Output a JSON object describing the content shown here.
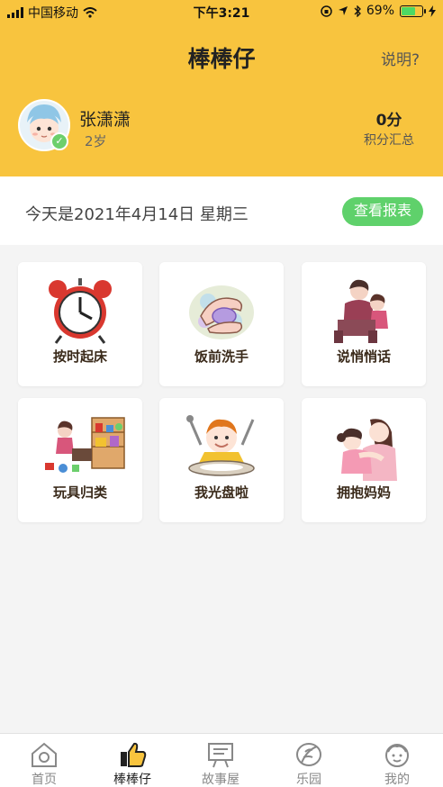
{
  "status_bar": {
    "carrier": "中国移动",
    "time": "下午3:21",
    "battery": "69%",
    "battery_level": 0.69
  },
  "header": {
    "title": "棒棒仔",
    "help": "说明?"
  },
  "profile": {
    "name": "张潇潇",
    "age": "2岁",
    "score": "0分",
    "score_label": "积分汇总"
  },
  "date_bar": {
    "date_text": "今天是2021年4月14日  星期三",
    "report_button": "查看报表"
  },
  "tasks": [
    {
      "label": "按时起床",
      "icon": "alarm-clock-icon"
    },
    {
      "label": "饭前洗手",
      "icon": "hand-washing-icon"
    },
    {
      "label": "说悄悄话",
      "icon": "whisper-icon"
    },
    {
      "label": "玩具归类",
      "icon": "toy-shelf-icon"
    },
    {
      "label": "我光盘啦",
      "icon": "clean-plate-icon"
    },
    {
      "label": "拥抱妈妈",
      "icon": "hug-mom-icon"
    }
  ],
  "tabbar": [
    {
      "label": "首页",
      "icon": "home-icon",
      "active": false
    },
    {
      "label": "棒棒仔",
      "icon": "thumbs-up-icon",
      "active": true
    },
    {
      "label": "故事屋",
      "icon": "story-board-icon",
      "active": false
    },
    {
      "label": "乐园",
      "icon": "leaf-icon",
      "active": false
    },
    {
      "label": "我的",
      "icon": "child-face-icon",
      "active": false
    }
  ],
  "colors": {
    "accent": "#f8c43e",
    "button_green": "#5fd16b",
    "background": "#f4f4f4"
  }
}
